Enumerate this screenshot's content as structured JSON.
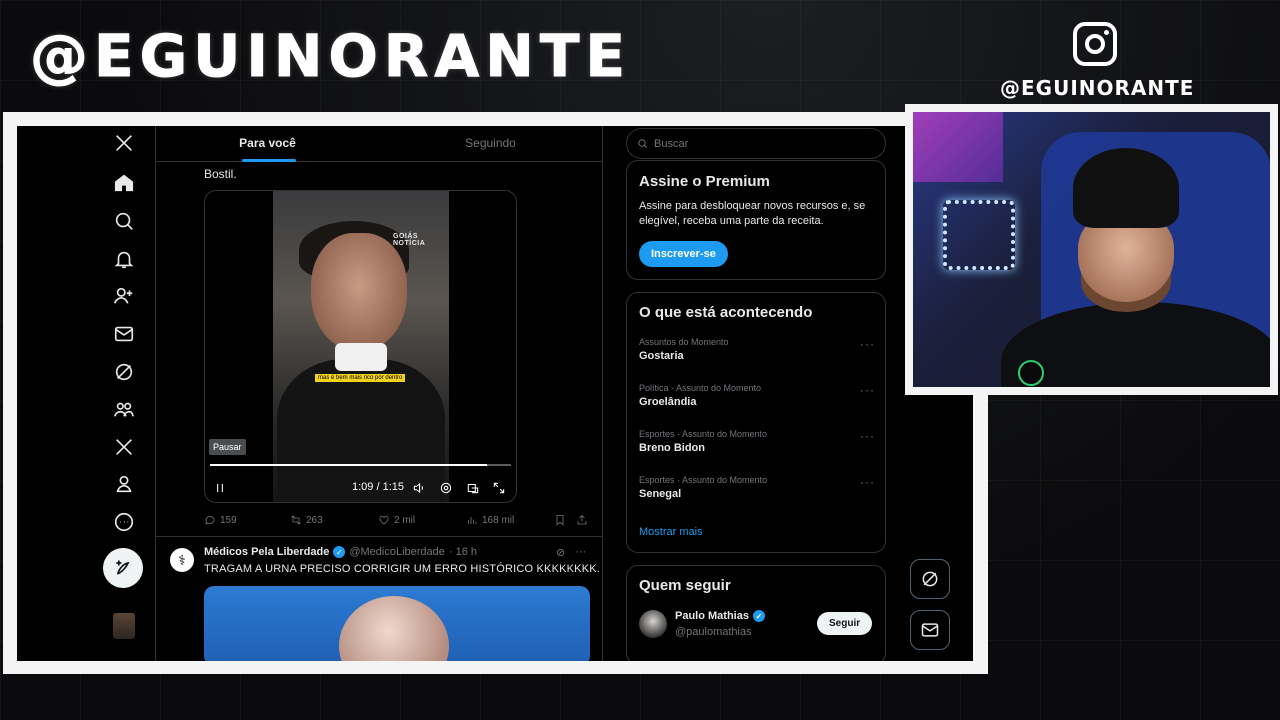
{
  "overlay": {
    "brand": "@EGUINORANTE",
    "ig_handle": "@EGUINORANTE"
  },
  "timeline": {
    "tabs": [
      "Para você",
      "Seguindo"
    ],
    "top_text": "Bostil.",
    "video": {
      "watermark": "GOIÁS NOTÍCIA",
      "caption": "mas é bem mais rico por dentro",
      "pause_tooltip": "Pausar",
      "time": "1:09 / 1:15",
      "progress": 0.92
    },
    "actions": {
      "replies": "159",
      "reposts": "263",
      "likes": "2 mil",
      "views": "168 mil"
    },
    "tweet2": {
      "name": "Médicos Pela Liberdade",
      "handle": "@MedicoLiberdade",
      "time": "· 16 h",
      "text": "TRAGAM A URNA PRECISO CORRIGIR UM ERRO HISTÓRICO KKKKKKKK."
    }
  },
  "right": {
    "search_placeholder": "Buscar",
    "premium": {
      "title": "Assine o Premium",
      "desc": "Assine para desbloquear novos recursos e, se elegível, receba uma parte da receita.",
      "button": "Inscrever-se"
    },
    "trends": {
      "title": "O que está acontecendo",
      "items": [
        {
          "category": "Assuntos do Momento",
          "name": "Gostaria"
        },
        {
          "category": "Política · Assunto do Momento",
          "name": "Groelândia"
        },
        {
          "category": "Esportes · Assunto do Momento",
          "name": "Breno Bidon"
        },
        {
          "category": "Esportes · Assunto do Momento",
          "name": "Senegal"
        }
      ],
      "show_more": "Mostrar mais"
    },
    "who_to_follow": {
      "title": "Quem seguir",
      "name": "Paulo Mathias",
      "handle": "@paulomathias",
      "button": "Seguir"
    }
  },
  "colors": {
    "accent": "#1d9bf0",
    "background": "#000000",
    "border": "#2f3336"
  },
  "icons": {
    "nav": [
      "x-logo-icon",
      "home-icon",
      "search-icon",
      "bell-icon",
      "add-user-icon",
      "mail-icon",
      "grok-icon",
      "communities-icon",
      "x-premium-icon",
      "profile-icon",
      "more-icon"
    ]
  }
}
